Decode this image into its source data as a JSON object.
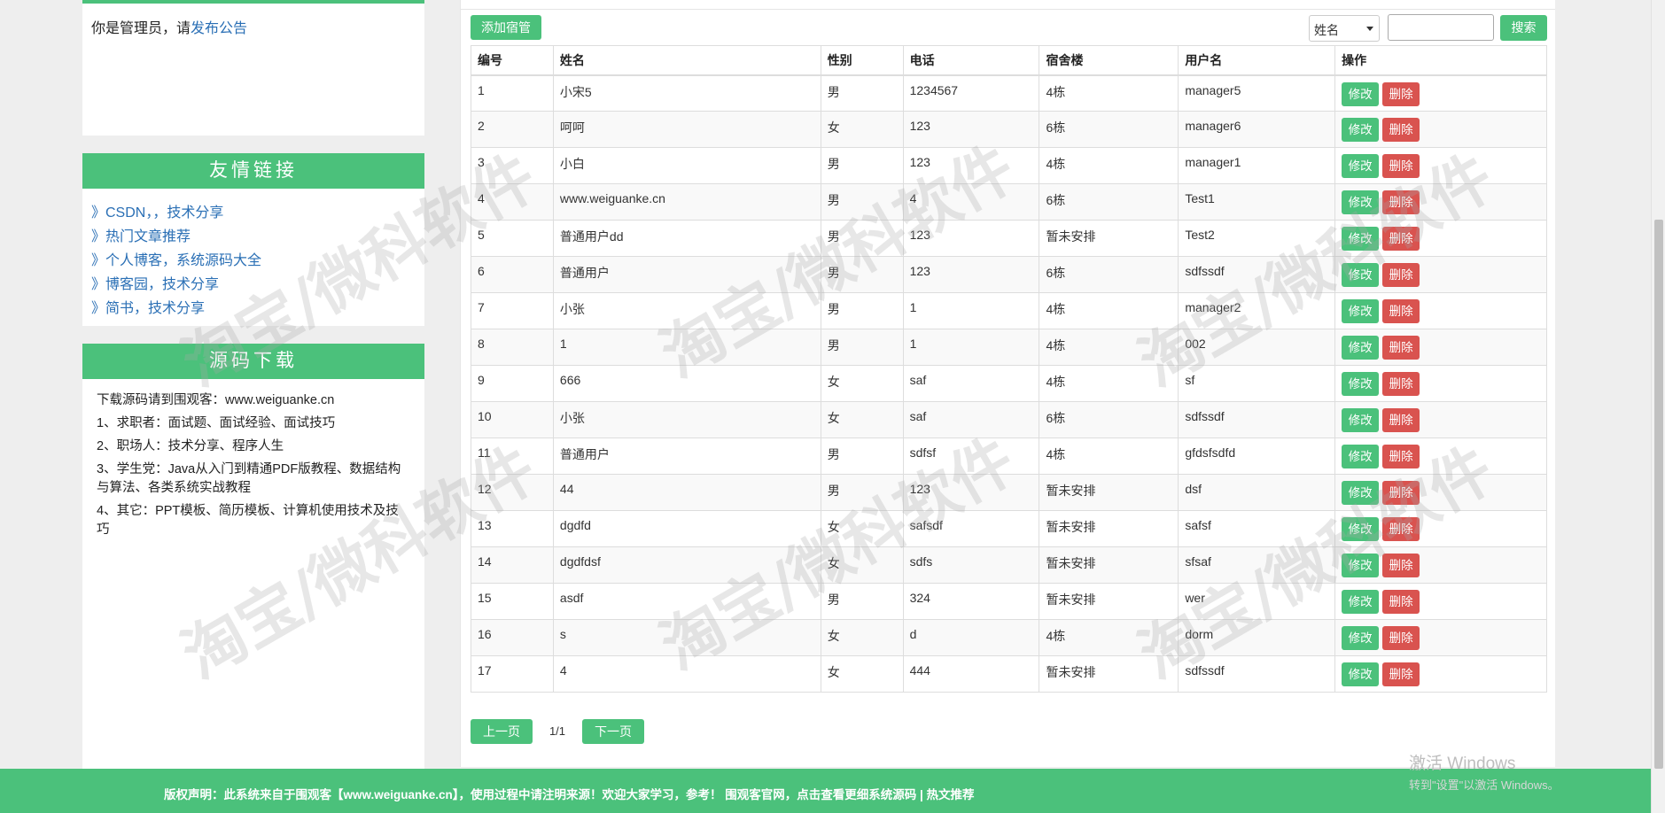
{
  "notice": {
    "prefix": "你是管理员，请",
    "link": "发布公告"
  },
  "friend_links": {
    "title": "友情链接",
    "items": [
      "》CSDN，，技术分享",
      "》热门文章推荐",
      "》个人博客，系统源码大全",
      "》博客园，技术分享",
      "》简书，技术分享"
    ]
  },
  "source_download": {
    "title": "源码下载",
    "lines": [
      "下载源码请到围观客：www.weiguanke.cn",
      "1、求职者：面试题、面试经验、面试技巧",
      "2、职场人：技术分享、程序人生",
      "3、学生党：Java从入门到精通PDF版教程、数据结构与算法、各类系统实战教程",
      "4、其它：PPT模板、简历模板、计算机使用技术及技巧"
    ]
  },
  "toolbar": {
    "add_label": "添加宿管",
    "search_field": "姓名",
    "search_value": "",
    "search_label": "搜索"
  },
  "table": {
    "headers": [
      "编号",
      "姓名",
      "性别",
      "电话",
      "宿舍楼",
      "用户名",
      "操作"
    ],
    "edit_label": "修改",
    "delete_label": "删除",
    "rows": [
      [
        "1",
        "小宋5",
        "男",
        "1234567",
        "4栋",
        "manager5"
      ],
      [
        "2",
        "呵呵",
        "女",
        "123",
        "6栋",
        "manager6"
      ],
      [
        "3",
        "小白",
        "男",
        "123",
        "4栋",
        "manager1"
      ],
      [
        "4",
        "www.weiguanke.cn",
        "男",
        "4",
        "6栋",
        "Test1"
      ],
      [
        "5",
        "普通用户dd",
        "男",
        "123",
        "暂未安排",
        "Test2"
      ],
      [
        "6",
        "普通用户",
        "男",
        "123",
        "6栋",
        "sdfssdf"
      ],
      [
        "7",
        "小张",
        "男",
        "1",
        "4栋",
        "manager2"
      ],
      [
        "8",
        "1",
        "男",
        "1",
        "4栋",
        "002"
      ],
      [
        "9",
        "666",
        "女",
        "saf",
        "4栋",
        "sf"
      ],
      [
        "10",
        "小张",
        "女",
        "saf",
        "6栋",
        "sdfssdf"
      ],
      [
        "11",
        "普通用户",
        "男",
        "sdfsf",
        "4栋",
        "gfdsfsdfd"
      ],
      [
        "12",
        "44",
        "男",
        "123",
        "暂未安排",
        "dsf"
      ],
      [
        "13",
        "dgdfd",
        "女",
        "safsdf",
        "暂未安排",
        "safsf"
      ],
      [
        "14",
        "dgdfdsf",
        "女",
        "sdfs",
        "暂未安排",
        "sfsaf"
      ],
      [
        "15",
        "asdf",
        "男",
        "324",
        "暂未安排",
        "wer"
      ],
      [
        "16",
        "s",
        "女",
        "d",
        "4栋",
        "dorm"
      ],
      [
        "17",
        "4",
        "女",
        "444",
        "暂未安排",
        "sdfssdf"
      ]
    ]
  },
  "pager": {
    "prev": "上一页",
    "info": "1/1",
    "next": "下一页"
  },
  "footer": {
    "text": "版权声明：此系统来自于围观客【www.weiguanke.cn】，使用过程中请注明来源！欢迎大家学习，参考！ 围观客官网，点击查看更细系统源码 | 热文推荐"
  },
  "windows": {
    "title": "激活 Windows",
    "subtitle": "转到\"设置\"以激活 Windows。"
  },
  "watermark": "淘宝/微科软件",
  "colors": {
    "accent": "#4bc17b",
    "danger": "#d9534f",
    "link": "#2a6fb5"
  }
}
